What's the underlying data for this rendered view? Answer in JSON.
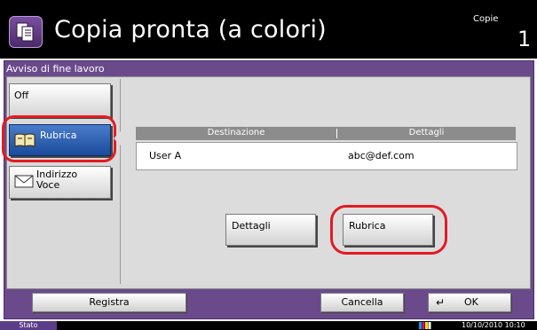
{
  "header": {
    "title": "Copia pronta (a colori)",
    "copies_label": "Copie",
    "copies_value": "1",
    "icon": "copy-icon"
  },
  "panel": {
    "title": "Avviso di fine lavoro"
  },
  "options": {
    "off": "Off",
    "rubrica": "Rubrica",
    "indirizzo_line1": "Indirizzo",
    "indirizzo_line2": "Voce",
    "selected": "Rubrica"
  },
  "table": {
    "columns": [
      "Destinazione",
      "Dettagli"
    ],
    "rows": [
      {
        "destinazione": "User A",
        "dettagli": "abc@def.com"
      }
    ]
  },
  "actions": {
    "dettagli": "Dettagli",
    "rubrica": "Rubrica"
  },
  "bottom": {
    "registra": "Registra",
    "cancella": "Cancella",
    "ok": "OK"
  },
  "status": {
    "label": "Stato",
    "datetime": "10/10/2010  10:10"
  },
  "colors": {
    "accent": "#6b4a8c",
    "selected": "#1b4a9a",
    "highlight_ring": "#e21b23"
  }
}
